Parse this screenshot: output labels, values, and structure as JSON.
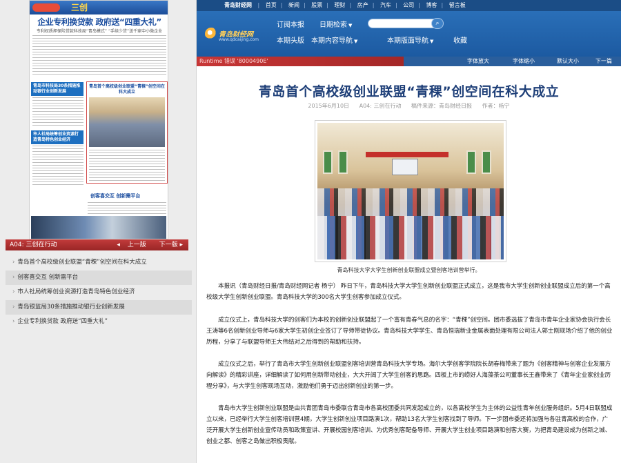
{
  "left_panel": {
    "newspaper_page": {
      "banner": "三创",
      "headline": "企业专利换贷款 政府送“四重大礼”",
      "sub": "专利权质押保险贷款科技局“青岛模式” “手续少贷”送千家中小微企业",
      "box1": "青岛市科技局30条措施推动银行业创新发展",
      "feature": "青岛首个高校级创业联盟“青稞”创空间在科大成立",
      "box2": "市人社局统筹创业资源打造青岛特色创业经济",
      "title2": "创客喜交互 创新需平台"
    },
    "page_bar": {
      "name": "A04: 三创在行动",
      "prev": "上一版",
      "next": "下一版"
    },
    "articles": [
      "青岛首个高校级创业联盟“青稞”创空间在科大成立",
      "创客喜交互 创新需平台",
      "市人社局统筹创业资源打造青岛特色创业经济",
      "青岛银监局30条措施推动银行业创新发展",
      "企业专利换贷款 政府送“四重大礼”"
    ]
  },
  "header": {
    "site_name": "青岛财经网",
    "nav": [
      "首页",
      "新闻",
      "股票",
      "理财",
      "房产",
      "汽车",
      "公司",
      "博客",
      "留言板"
    ],
    "logo_text": "青岛财经网",
    "logo_url": "www.qdcaijing.com",
    "links": {
      "subscribe": "订阅本报",
      "date_search": "日期检索",
      "headline": "本期头版",
      "content_nav": "本期内容导航",
      "page_nav": "本期版面导航",
      "favorite": "收藏"
    }
  },
  "ticker": "Runtime 错误 '8000490E'",
  "tools": {
    "enlarge": "字体放大",
    "shrink": "字体缩小",
    "default": "默认大小",
    "next": "下一篇"
  },
  "article": {
    "title": "青岛首个高校级创业联盟“青稞”创空间在科大成立",
    "date": "2015年6月10日",
    "section": "A04: 三创在行动",
    "source": "稿件来源：青岛财经日报",
    "author": "作者：杨宁",
    "caption": "青岛科技大学大学生创新创业联盟成立暨创客培训营举行。",
    "paragraphs": [
      "本报讯（青岛财经日报/青岛财经网记者 杨宁） 昨日下午，青岛科技大学大学生创新创业联盟正式成立，这是我市大学生创新创业联盟成立后的第一个高校级大学生创新创业联盟。青岛科技大学的300名大学生创客参加成立仪式。",
      "成立仪式上，青岛科技大学的创客们为本校的创新创业联盟起了一个富有青春气息的名字：“青稞”创空间。团市委选拔了青岛市青年企业家协会执行会长王涛等6名创新创业导师与6家大学生初创企业签订了导师带徒协议。青岛科技大学学生、青岛恒瑞新业金属表面处理有限公司法人郭士刚现场介绍了他的创业历程，分享了与联盟导师王大伟结对之后得到的帮助和扶持。",
      "成立仪式之后，举行了青岛市大学生创新创业联盟创客培训营青岛科技大学专场。海尔大学创客学院院长胡春梅带来了题为《创客精神与创客企业发展方向解读》的精彩讲座，详细解读了如何用创新带动创业，大大开阔了大学生创客的思路。四板上市的崂好人海藻茶公司董事长王鑫带来了《青年企业家创业历程分享》，与大学生创客现场互动，激励他们勇于迈出创新创业的第一步。",
      "青岛市大学生创新创业联盟是由共青团青岛市委联合青岛市各高校团委共同发起成立的，以各高校学生为主体的公益性青年创业服务组织。5月4日联盟成立以来，已经举行大学生创客培训营4期，大学生创新创业项目路演1次，帮助13名大学生创客找到了导师。下一步团市委还将加强与各驻青高校的合作，广泛开展大学生创新创业宣传动员和政策宣讲、开展校园创客培训、为优秀创客配备导师、开展大学生创业项目路演和创客大赛，为把青岛建设成为创新之城、创业之都、创客之岛做出积极贡献。"
    ]
  }
}
